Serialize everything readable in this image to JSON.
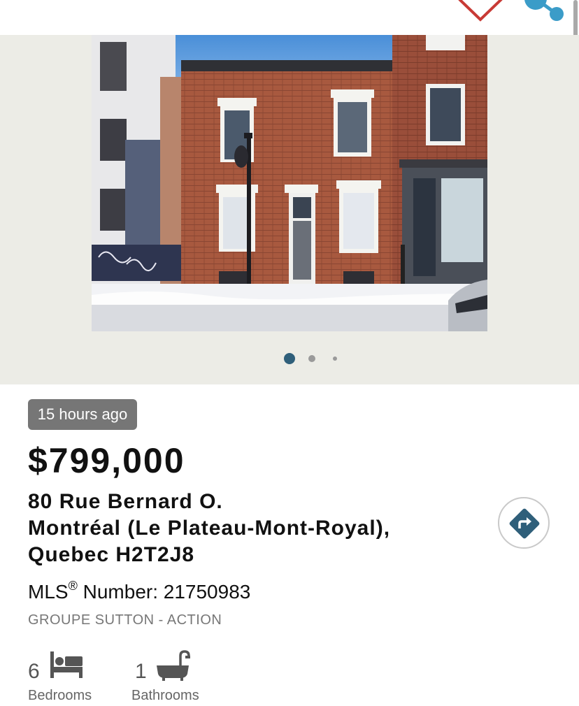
{
  "header": {
    "favorite_icon": "heart-outline-icon",
    "share_icon": "share-icon",
    "accent_color": "#2f5f7a",
    "heart_color": "#c83a35"
  },
  "gallery": {
    "photo_description": "Brick row house on snowy Montreal street",
    "slides_total": 3,
    "active_slide": 1
  },
  "listing": {
    "posted": "15 hours ago",
    "price": "$799,000",
    "address_line1": "80 Rue Bernard O.",
    "address_line2": "Montréal (Le Plateau-Mont-Royal),",
    "address_line3": "Quebec H2T2J8",
    "mls_label": "MLS",
    "mls_reg": "®",
    "mls_suffix": " Number: 21750983",
    "agency": "GROUPE SUTTON - ACTION",
    "directions_icon": "directions-icon"
  },
  "features": [
    {
      "value": "6",
      "label": "Bedrooms",
      "icon": "bed-icon"
    },
    {
      "value": "1",
      "label": "Bathrooms",
      "icon": "bathtub-icon"
    }
  ]
}
